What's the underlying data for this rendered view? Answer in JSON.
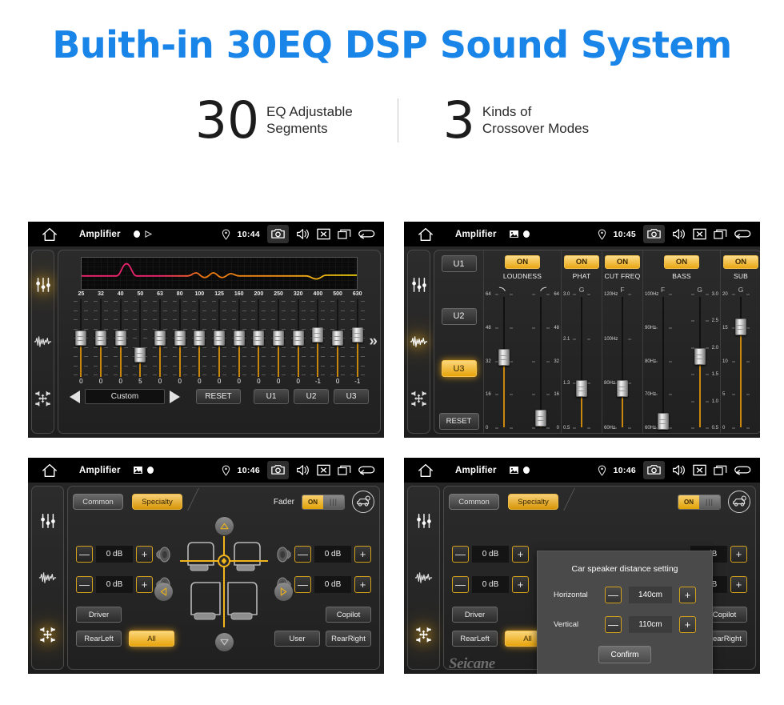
{
  "hero": {
    "title": "Buith-in 30EQ DSP Sound System",
    "stats": [
      {
        "number": "30",
        "line1": "EQ Adjustable",
        "line2": "Segments"
      },
      {
        "number": "3",
        "line1": "Kinds of",
        "line2": "Crossover Modes"
      }
    ],
    "title_color": "#1a85e8"
  },
  "accent": {
    "amber": "#e8a40c",
    "amber_light": "#fbd67a",
    "track": "#c8860d"
  },
  "watermark": "Seicane",
  "statusbar": {
    "home_icon": "home-icon",
    "title": "Amplifier",
    "icons": [
      "location-pin-icon",
      "camera-icon",
      "volume-icon",
      "close-x-icon",
      "recents-icon",
      "back-arrow-icon"
    ],
    "times": [
      "10:44",
      "10:45",
      "10:46",
      "10:46"
    ]
  },
  "sidebar": {
    "items": [
      {
        "name": "equalizer-icon",
        "label": "Equalizer"
      },
      {
        "name": "waveform-icon",
        "label": "Crossover"
      },
      {
        "name": "balance-icon",
        "label": "Balance"
      }
    ]
  },
  "screen_eq": {
    "active_sidebar": 0,
    "graph": {
      "peak_band": "40",
      "curve_colors": [
        "#f0246e",
        "#f07a10",
        "#f2d40a"
      ]
    },
    "bands": [
      "25",
      "32",
      "40",
      "50",
      "63",
      "80",
      "100",
      "125",
      "160",
      "200",
      "250",
      "320",
      "400",
      "500",
      "630"
    ],
    "values": [
      "0",
      "0",
      "0",
      "5",
      "0",
      "0",
      "0",
      "0",
      "0",
      "0",
      "0",
      "0",
      "-1",
      "0",
      "-1"
    ],
    "knob_levels": [
      50,
      50,
      50,
      72,
      50,
      50,
      50,
      50,
      50,
      50,
      50,
      50,
      46,
      50,
      46
    ],
    "more_icon": "chevron-double-right-icon",
    "prev_icon": "prev-triangle-icon",
    "next_icon": "next-triangle-icon",
    "preset_name": "Custom",
    "reset_label": "RESET",
    "user_presets": [
      "U1",
      "U2",
      "U3"
    ]
  },
  "screen_crossover": {
    "active_sidebar": 1,
    "presets": [
      "U1",
      "U2",
      "U3"
    ],
    "active_preset": "U3",
    "reset_label": "RESET",
    "sections": [
      {
        "name": "LOUDNESS",
        "state": "ON",
        "sliders": [
          {
            "axis": "lowpass-curve-icon",
            "scale": [
              "64",
              "48",
              "32",
              "16",
              "0"
            ],
            "value": 32,
            "pos": 47
          },
          {
            "axis": "highpass-curve-icon",
            "scale": [
              "64",
              "48",
              "32",
              "16",
              "0"
            ],
            "value": 4,
            "pos": 92
          }
        ]
      },
      {
        "name": "PHAT",
        "state": "ON",
        "sliders": [
          {
            "axis": "G",
            "scale": [
              "3.0",
              "2.1",
              "1.3",
              "0.5"
            ],
            "value": 1.3,
            "pos": 70
          }
        ]
      },
      {
        "name": "CUT FREQ",
        "state": "ON",
        "sliders": [
          {
            "axis": "F",
            "scale": [
              "120Hz",
              "100Hz",
              "80Hz",
              "60Hz"
            ],
            "value": "80Hz",
            "pos": 70
          }
        ]
      },
      {
        "name": "BASS",
        "state": "ON",
        "sliders": [
          {
            "axis": "F",
            "scale": [
              "100Hz",
              "90Hz",
              "80Hz",
              "70Hz",
              "60Hz"
            ],
            "value": "60Hz",
            "pos": 94
          },
          {
            "axis": "G",
            "scale": [
              "3.0",
              "2.5",
              "2.0",
              "1.5",
              "1.0",
              "0.5"
            ],
            "value": 2.0,
            "pos": 46
          }
        ]
      },
      {
        "name": "SUB",
        "state": "ON",
        "sliders": [
          {
            "axis": "G",
            "scale": [
              "20",
              "15",
              "10",
              "5",
              "0"
            ],
            "value": 15,
            "pos": 24
          }
        ]
      }
    ]
  },
  "screen_fader": {
    "active_sidebar": 2,
    "tabs": [
      {
        "label": "Common",
        "active": false
      },
      {
        "label": "Specialty",
        "active": true
      }
    ],
    "fader_label": "Fader",
    "fader_state": "ON",
    "car_setting_icon": "car-settings-icon",
    "gains": [
      {
        "position": "front-left",
        "value": "0 dB"
      },
      {
        "position": "front-right",
        "value": "0 dB"
      },
      {
        "position": "rear-left",
        "value": "0 dB"
      },
      {
        "position": "rear-right",
        "value": "0 dB"
      }
    ],
    "minus": "—",
    "plus": "+",
    "nav_arrows": [
      "up-arrow-icon",
      "down-arrow-icon",
      "left-arrow-icon",
      "right-arrow-icon"
    ],
    "presets": [
      {
        "label": "Driver",
        "active": false
      },
      {
        "label": "Copilot",
        "active": false
      },
      {
        "label": "RearLeft",
        "active": false
      },
      {
        "label": "All",
        "active": true
      },
      {
        "label": "User",
        "active": false
      },
      {
        "label": "RearRight",
        "active": false
      }
    ]
  },
  "screen_dialog": {
    "active_sidebar": 2,
    "title": "Car speaker distance setting",
    "rows": [
      {
        "label": "Horizontal",
        "value": "140cm"
      },
      {
        "label": "Vertical",
        "value": "110cm"
      }
    ],
    "confirm_label": "Confirm",
    "minus": "—",
    "plus": "+"
  }
}
